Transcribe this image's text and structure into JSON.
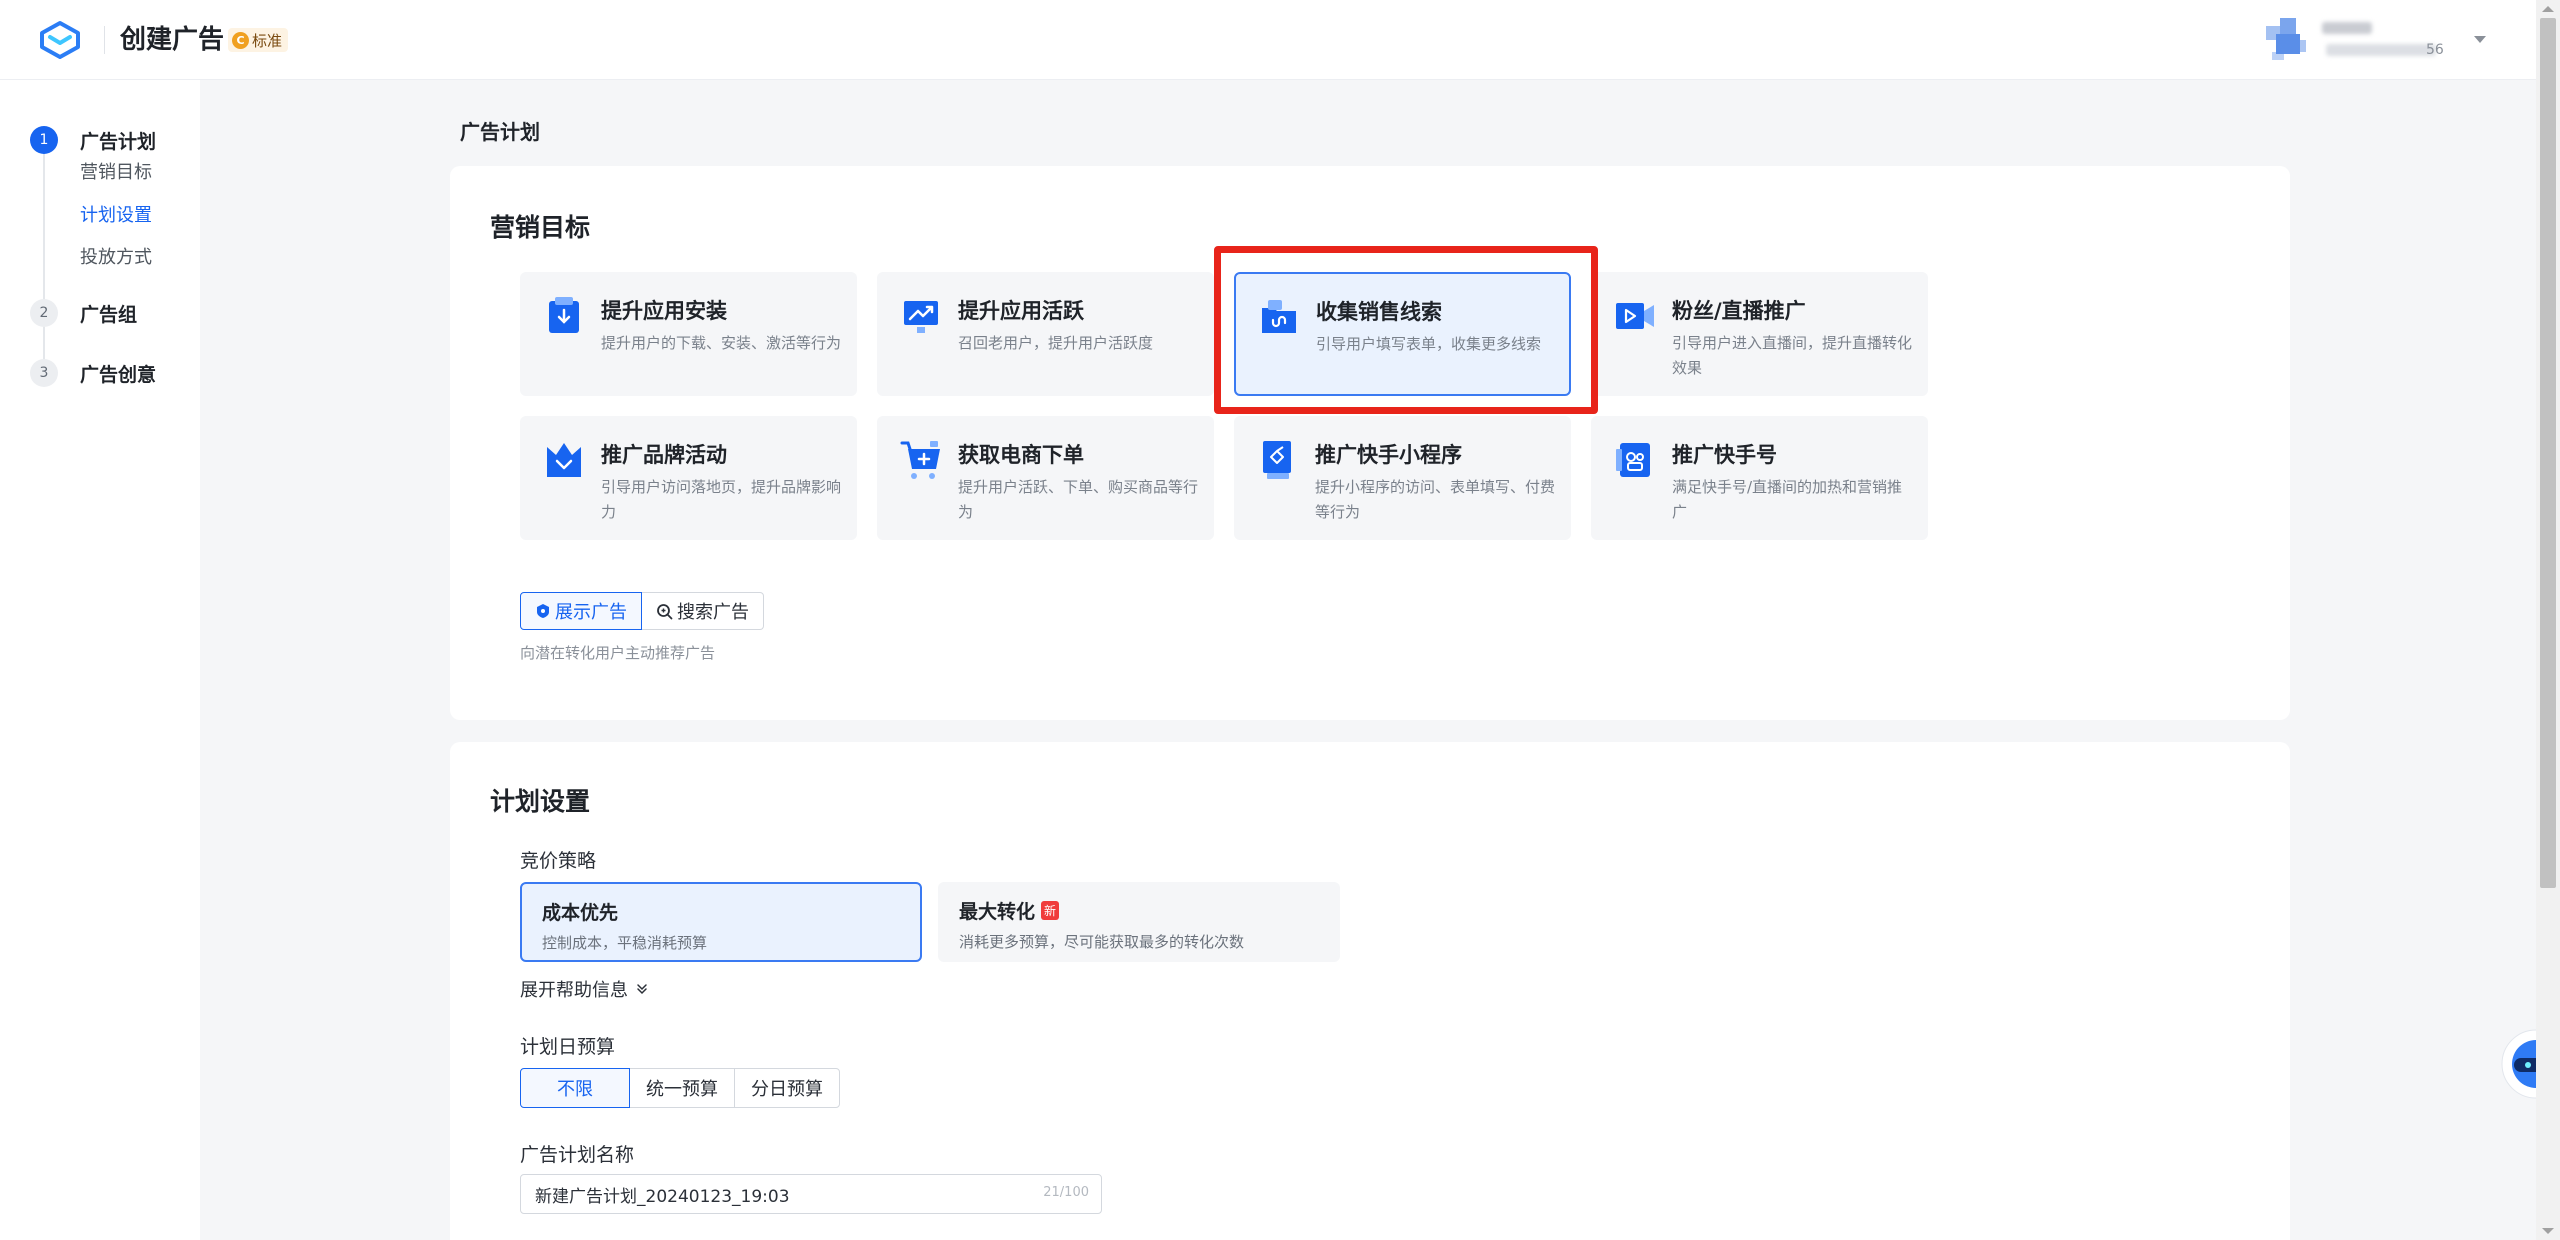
{
  "header": {
    "title": "创建广告",
    "edition_badge": "标准",
    "user_id_tail": "56"
  },
  "sidebar": {
    "steps": [
      {
        "num": "1",
        "label": "广告计划"
      },
      {
        "num": "2",
        "label": "广告组"
      },
      {
        "num": "3",
        "label": "广告创意"
      }
    ],
    "substeps": [
      "营销目标",
      "计划设置",
      "投放方式"
    ]
  },
  "page_title": "广告计划",
  "marketing": {
    "title": "营销目标",
    "goals": [
      {
        "title": "提升应用安装",
        "desc": "提升用户的下载、安装、激活等行为"
      },
      {
        "title": "提升应用活跃",
        "desc": "召回老用户，提升用户活跃度"
      },
      {
        "title": "收集销售线索",
        "desc": "引导用户填写表单，收集更多线索"
      },
      {
        "title": "粉丝/直播推广",
        "desc": "引导用户进入直播间，提升直播转化效果"
      },
      {
        "title": "推广品牌活动",
        "desc": "引导用户访问落地页，提升品牌影响力"
      },
      {
        "title": "获取电商下单",
        "desc": "提升用户活跃、下单、购买商品等行为"
      },
      {
        "title": "推广快手小程序",
        "desc": "提升小程序的访问、表单填写、付费等行为"
      },
      {
        "title": "推广快手号",
        "desc": "满足快手号/直播间的加热和营销推广"
      }
    ],
    "ad_types": [
      "展示广告",
      "搜索广告"
    ],
    "ad_type_hint": "向潜在转化用户主动推荐广告"
  },
  "plan": {
    "title": "计划设置",
    "bid_label": "竞价策略",
    "bid_options": [
      {
        "title": "成本优先",
        "desc": "控制成本，平稳消耗预算"
      },
      {
        "title": "最大转化",
        "badge": "新",
        "desc": "消耗更多预算，尽可能获取最多的转化次数"
      }
    ],
    "expand_help": "展开帮助信息",
    "budget_label": "计划日预算",
    "budget_options": [
      "不限",
      "统一预算",
      "分日预算"
    ],
    "name_label": "广告计划名称",
    "name_value": "新建广告计划_20240123_19:03",
    "name_count": "21/100"
  },
  "colors": {
    "primary": "#1764f0",
    "highlight": "#e8241a",
    "selected_bg": "#eaf2fe"
  }
}
